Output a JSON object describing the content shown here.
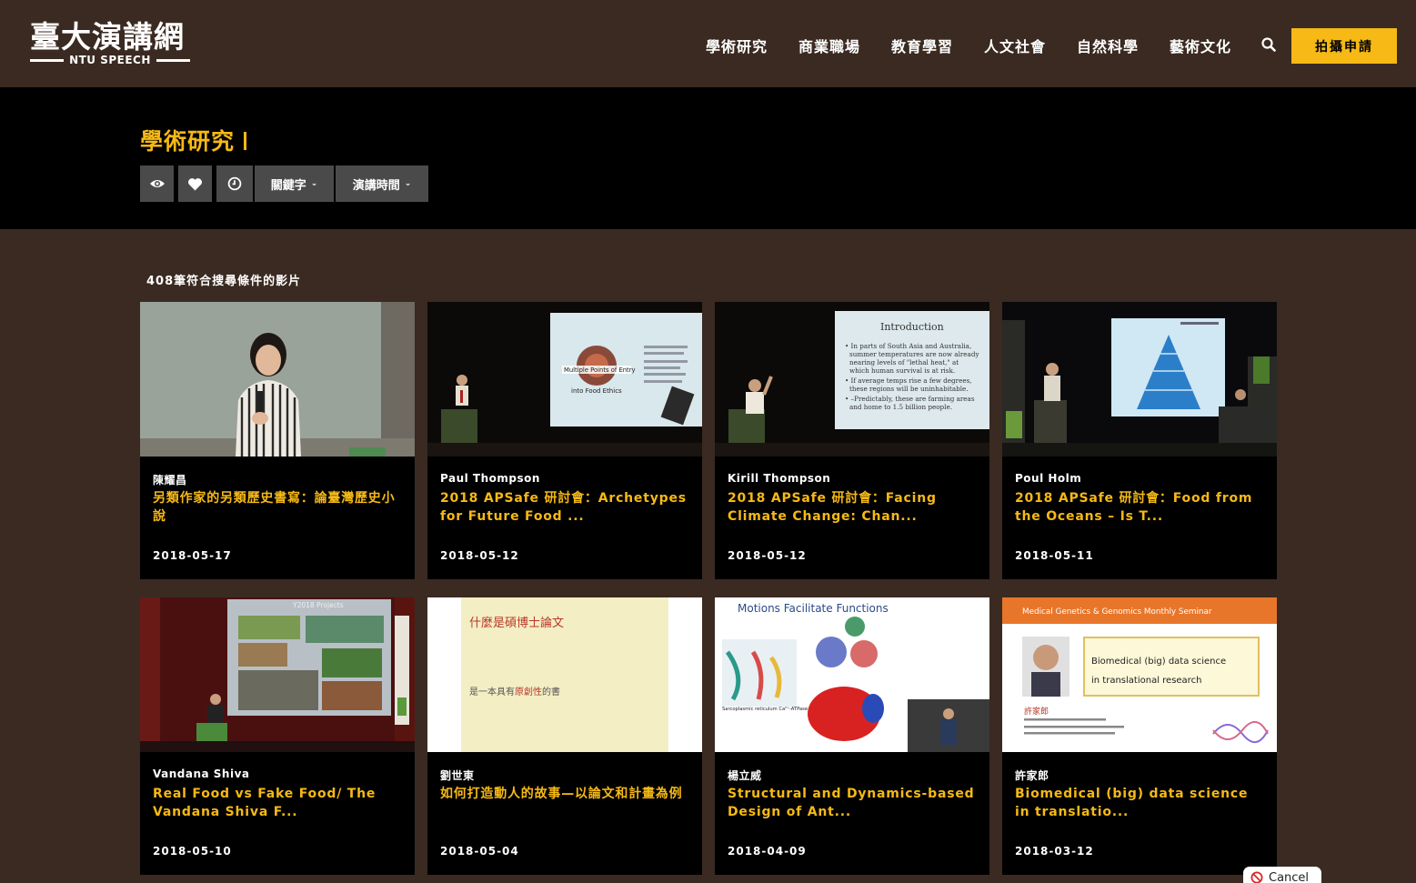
{
  "header": {
    "logo_cn": "臺大演講網",
    "logo_en": "NTU SPEECH",
    "nav": [
      "學術研究",
      "商業職場",
      "教育學習",
      "人文社會",
      "自然科學",
      "藝術文化"
    ],
    "apply_label": "拍攝申請"
  },
  "banner": {
    "title": "學術研究",
    "keyword_label": "關鍵字",
    "time_label": "演講時間"
  },
  "results": {
    "count_text": "408筆符合搜尋條件的影片",
    "cards": [
      {
        "speaker": "陳耀昌",
        "title": "另類作家的另類歷史書寫：論臺灣歷史小說",
        "date": "2018-05-17"
      },
      {
        "speaker": "Paul Thompson",
        "title": "2018 APSafe 研討會：Archetypes for Future Food ...",
        "date": "2018-05-12"
      },
      {
        "speaker": "Kirill Thompson",
        "title": "2018 APSafe 研討會：Facing Climate Change: Chan...",
        "date": "2018-05-12"
      },
      {
        "speaker": "Poul Holm",
        "title": "2018 APSafe 研討會：Food from the Oceans – Is T...",
        "date": "2018-05-11"
      },
      {
        "speaker": "Vandana Shiva",
        "title": "Real Food vs Fake Food/ The Vandana Shiva F...",
        "date": "2018-05-10"
      },
      {
        "speaker": "劉世東",
        "title": "如何打造動人的故事—以論文和計畫為例",
        "date": "2018-05-04"
      },
      {
        "speaker": "楊立威",
        "title": "Structural and Dynamics-based Design of Ant...",
        "date": "2018-04-09"
      },
      {
        "speaker": "許家郎",
        "title": "Biomedical (big) data science in translatio...",
        "date": "2018-03-12"
      }
    ]
  },
  "thumbnails": {
    "t2_line1": "Multiple Points of Entry",
    "t2_line2": "into Food Ethics",
    "t3_heading": "Introduction",
    "t3_lines": [
      "• In parts of South Asia and Australia,",
      "summer temperatures are now already",
      "nearing levels of \"lethal heat,\" at",
      "which human survival is at risk.",
      "• If average temps rise a few degrees,",
      "these regions will be uninhabitable.",
      "• –Predictably, these are farming areas",
      "and home to 1.5 billion people."
    ],
    "t5_heading": "Y2018 Projects",
    "t6_heading": "什麼是碩博士論文",
    "t6_line_pre": "是一本具有",
    "t6_line_em": "原創性",
    "t6_line_post": "的書",
    "t7_heading": "Motions Facilitate Functions",
    "t7_sub": "Sarcoplasmic reticulum Ca²⁺-ATPase",
    "t8_banner": "Medical Genetics & Genomics Monthly Seminar",
    "t8_box_l1": "Biomedical (big) data science",
    "t8_box_l2": "in translational research",
    "t8_name": "許家郎"
  },
  "cancel_label": "Cancel",
  "colors": {
    "header_bg": "#3a2a21",
    "accent": "#f6b915",
    "banner_bg": "#000000",
    "button_bg": "#4a4a4a"
  },
  "icons": [
    "eye-icon",
    "heart-icon",
    "clock-icon",
    "search-icon",
    "cancel-icon"
  ]
}
